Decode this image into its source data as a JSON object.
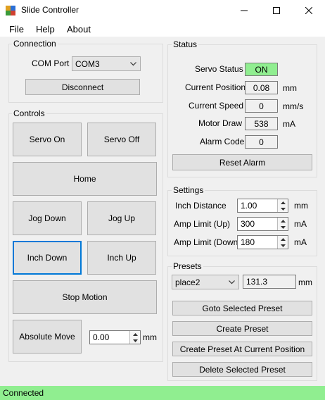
{
  "window": {
    "title": "Slide Controller",
    "minimize_icon": "minimize-icon",
    "maximize_icon": "maximize-icon",
    "close_icon": "close-icon"
  },
  "menu": {
    "file": "File",
    "help": "Help",
    "about": "About"
  },
  "connection": {
    "title": "Connection",
    "com_port_label": "COM Port",
    "com_port_value": "COM3",
    "disconnect": "Disconnect"
  },
  "controls": {
    "title": "Controls",
    "servo_on": "Servo On",
    "servo_off": "Servo Off",
    "home": "Home",
    "jog_down": "Jog Down",
    "jog_up": "Jog Up",
    "inch_down": "Inch Down",
    "inch_up": "Inch Up",
    "stop_motion": "Stop Motion",
    "absolute_move": "Absolute Move",
    "absolute_value": "0.00",
    "absolute_unit": "mm"
  },
  "status": {
    "title": "Status",
    "servo_status_label": "Servo Status",
    "servo_status_value": "ON",
    "servo_status_color": "#90ee90",
    "position_label": "Current Position",
    "position_value": "0.08",
    "position_unit": "mm",
    "speed_label": "Current Speed",
    "speed_value": "0",
    "speed_unit": "mm/s",
    "motor_label": "Motor Draw",
    "motor_value": "538",
    "motor_unit": "mA",
    "alarm_label": "Alarm Code",
    "alarm_value": "0",
    "reset_alarm": "Reset Alarm"
  },
  "settings": {
    "title": "Settings",
    "inch_distance_label": "Inch Distance",
    "inch_distance_value": "1.00",
    "inch_distance_unit": "mm",
    "amp_up_label": "Amp Limit (Up)",
    "amp_up_value": "300",
    "amp_up_unit": "mA",
    "amp_down_label": "Amp Limit (Down)",
    "amp_down_value": "180",
    "amp_down_unit": "mA"
  },
  "presets": {
    "title": "Presets",
    "selected": "place2",
    "preset_value": "131.3",
    "preset_unit": "mm",
    "goto": "Goto Selected Preset",
    "create": "Create Preset",
    "create_current": "Create Preset At Current Position",
    "delete": "Delete Selected Preset"
  },
  "statusbar": {
    "text": "Connected",
    "color": "#90ee90"
  }
}
